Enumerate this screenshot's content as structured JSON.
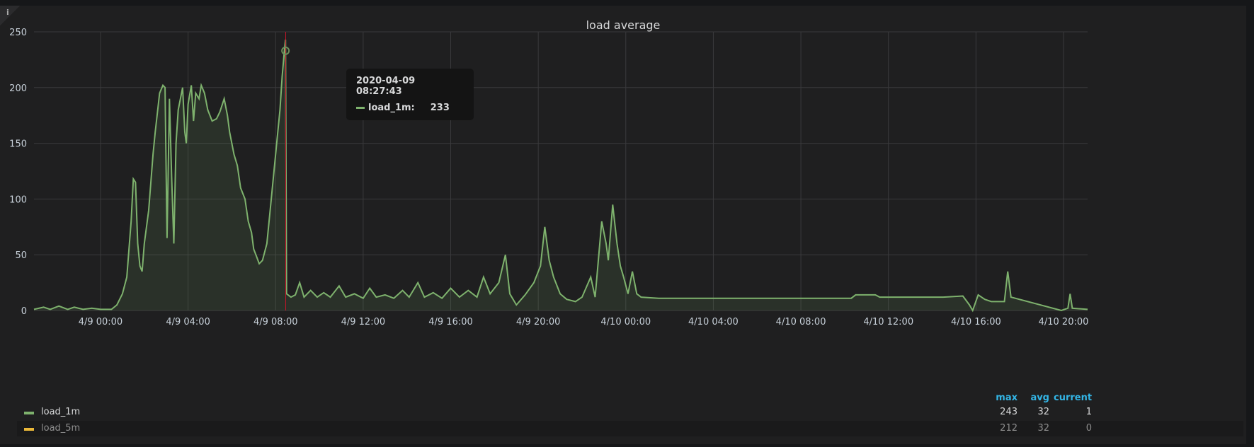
{
  "panel": {
    "title": "load average",
    "info_icon": "i"
  },
  "tooltip": {
    "time": "2020-04-09 08:27:43",
    "series": "load_1m:",
    "value": "233"
  },
  "legend": {
    "headers": [
      "max",
      "avg",
      "current"
    ],
    "rows": [
      {
        "name": "load_1m",
        "color": "#7eb26d",
        "max": "243",
        "avg": "32",
        "current": "1"
      },
      {
        "name": "load_5m",
        "color": "#eab839",
        "max": "212",
        "avg": "32",
        "current": "0"
      }
    ]
  },
  "chart_data": {
    "type": "area",
    "title": "load average",
    "x_unit": "hours since 2020-04-09 00:00",
    "xlim": [
      -3.04,
      45.1
    ],
    "ylim": [
      0,
      250
    ],
    "yticks": [
      0,
      50,
      100,
      150,
      200,
      250
    ],
    "xticks": [
      {
        "h": 0,
        "label": "4/9 00:00"
      },
      {
        "h": 4,
        "label": "4/9 04:00"
      },
      {
        "h": 8,
        "label": "4/9 08:00"
      },
      {
        "h": 12,
        "label": "4/9 12:00"
      },
      {
        "h": 16,
        "label": "4/9 16:00"
      },
      {
        "h": 20,
        "label": "4/9 20:00"
      },
      {
        "h": 24,
        "label": "4/10 00:00"
      },
      {
        "h": 28,
        "label": "4/10 04:00"
      },
      {
        "h": 32,
        "label": "4/10 08:00"
      },
      {
        "h": 36,
        "label": "4/10 12:00"
      },
      {
        "h": 40,
        "label": "4/10 16:00"
      },
      {
        "h": 44,
        "label": "4/10 20:00"
      }
    ],
    "grid": true,
    "cursor_h": 8.46,
    "hover_point": {
      "h": 8.45,
      "v": 233
    },
    "series": [
      {
        "name": "load_1m",
        "color": "#7eb26d",
        "points": [
          [
            -3.04,
            1
          ],
          [
            -2.6,
            3
          ],
          [
            -2.3,
            1
          ],
          [
            -1.9,
            4
          ],
          [
            -1.5,
            1
          ],
          [
            -1.2,
            3
          ],
          [
            -0.8,
            1
          ],
          [
            -0.4,
            2
          ],
          [
            0,
            1
          ],
          [
            0.5,
            1
          ],
          [
            0.75,
            5
          ],
          [
            1.0,
            15
          ],
          [
            1.2,
            30
          ],
          [
            1.4,
            80
          ],
          [
            1.5,
            118
          ],
          [
            1.6,
            115
          ],
          [
            1.7,
            60
          ],
          [
            1.8,
            40
          ],
          [
            1.9,
            35
          ],
          [
            2.0,
            60
          ],
          [
            2.2,
            90
          ],
          [
            2.4,
            140
          ],
          [
            2.5,
            160
          ],
          [
            2.7,
            195
          ],
          [
            2.85,
            202
          ],
          [
            2.95,
            200
          ],
          [
            3.04,
            65
          ],
          [
            3.15,
            190
          ],
          [
            3.25,
            120
          ],
          [
            3.35,
            60
          ],
          [
            3.45,
            150
          ],
          [
            3.55,
            180
          ],
          [
            3.75,
            200
          ],
          [
            3.85,
            160
          ],
          [
            3.92,
            150
          ],
          [
            4.0,
            185
          ],
          [
            4.15,
            202
          ],
          [
            4.25,
            170
          ],
          [
            4.35,
            195
          ],
          [
            4.5,
            190
          ],
          [
            4.6,
            202
          ],
          [
            4.75,
            195
          ],
          [
            4.9,
            180
          ],
          [
            5.1,
            170
          ],
          [
            5.3,
            172
          ],
          [
            5.45,
            178
          ],
          [
            5.65,
            190
          ],
          [
            5.8,
            175
          ],
          [
            5.9,
            160
          ],
          [
            6.1,
            140
          ],
          [
            6.25,
            130
          ],
          [
            6.4,
            110
          ],
          [
            6.6,
            100
          ],
          [
            6.75,
            80
          ],
          [
            6.9,
            70
          ],
          [
            7.0,
            55
          ],
          [
            7.1,
            50
          ],
          [
            7.25,
            42
          ],
          [
            7.4,
            45
          ],
          [
            7.6,
            60
          ],
          [
            7.8,
            100
          ],
          [
            7.95,
            130
          ],
          [
            8.1,
            160
          ],
          [
            8.2,
            180
          ],
          [
            8.3,
            210
          ],
          [
            8.4,
            233
          ],
          [
            8.45,
            243
          ],
          [
            8.5,
            15
          ],
          [
            8.7,
            12
          ],
          [
            8.9,
            14
          ],
          [
            9.1,
            25
          ],
          [
            9.3,
            12
          ],
          [
            9.6,
            18
          ],
          [
            9.9,
            12
          ],
          [
            10.2,
            16
          ],
          [
            10.5,
            12
          ],
          [
            10.9,
            22
          ],
          [
            11.2,
            12
          ],
          [
            11.6,
            15
          ],
          [
            12.0,
            11
          ],
          [
            12.3,
            20
          ],
          [
            12.6,
            12
          ],
          [
            13.0,
            14
          ],
          [
            13.4,
            11
          ],
          [
            13.8,
            18
          ],
          [
            14.1,
            12
          ],
          [
            14.5,
            25
          ],
          [
            14.8,
            12
          ],
          [
            15.2,
            16
          ],
          [
            15.6,
            11
          ],
          [
            16.0,
            20
          ],
          [
            16.4,
            12
          ],
          [
            16.8,
            18
          ],
          [
            17.2,
            12
          ],
          [
            17.5,
            30
          ],
          [
            17.8,
            15
          ],
          [
            18.2,
            25
          ],
          [
            18.5,
            50
          ],
          [
            18.7,
            15
          ],
          [
            19.0,
            5
          ],
          [
            19.4,
            14
          ],
          [
            19.8,
            25
          ],
          [
            20.1,
            40
          ],
          [
            20.3,
            75
          ],
          [
            20.5,
            45
          ],
          [
            20.7,
            30
          ],
          [
            21.0,
            15
          ],
          [
            21.3,
            10
          ],
          [
            21.7,
            8
          ],
          [
            22.0,
            12
          ],
          [
            22.4,
            30
          ],
          [
            22.6,
            12
          ],
          [
            22.9,
            80
          ],
          [
            23.1,
            60
          ],
          [
            23.2,
            45
          ],
          [
            23.4,
            95
          ],
          [
            23.6,
            60
          ],
          [
            23.75,
            40
          ],
          [
            23.9,
            30
          ],
          [
            24.1,
            15
          ],
          [
            24.3,
            35
          ],
          [
            24.5,
            15
          ],
          [
            24.7,
            12
          ],
          [
            25.5,
            11
          ],
          [
            27,
            11
          ],
          [
            29,
            11
          ],
          [
            31,
            11
          ],
          [
            33,
            11
          ],
          [
            34.3,
            11
          ],
          [
            34.5,
            14
          ],
          [
            35.4,
            14
          ],
          [
            35.6,
            12
          ],
          [
            37,
            12
          ],
          [
            38.5,
            12
          ],
          [
            39.4,
            13
          ],
          [
            39.7,
            5
          ],
          [
            39.85,
            0
          ],
          [
            40.1,
            14
          ],
          [
            40.4,
            10
          ],
          [
            40.7,
            8
          ],
          [
            41.3,
            8
          ],
          [
            41.45,
            35
          ],
          [
            41.6,
            12
          ],
          [
            43.9,
            0
          ],
          [
            44.2,
            2
          ],
          [
            44.3,
            15
          ],
          [
            44.4,
            2
          ],
          [
            45.1,
            1
          ]
        ]
      }
    ]
  }
}
